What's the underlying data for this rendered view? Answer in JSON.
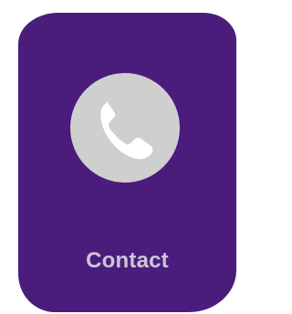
{
  "contact_tile": {
    "label": "Contact",
    "icon": "phone-icon",
    "colors": {
      "background": "#4a1d7c",
      "icon_circle": "#cfcfcf",
      "icon_glyph": "#ffffff",
      "label_text": "#cdc6d8"
    }
  }
}
